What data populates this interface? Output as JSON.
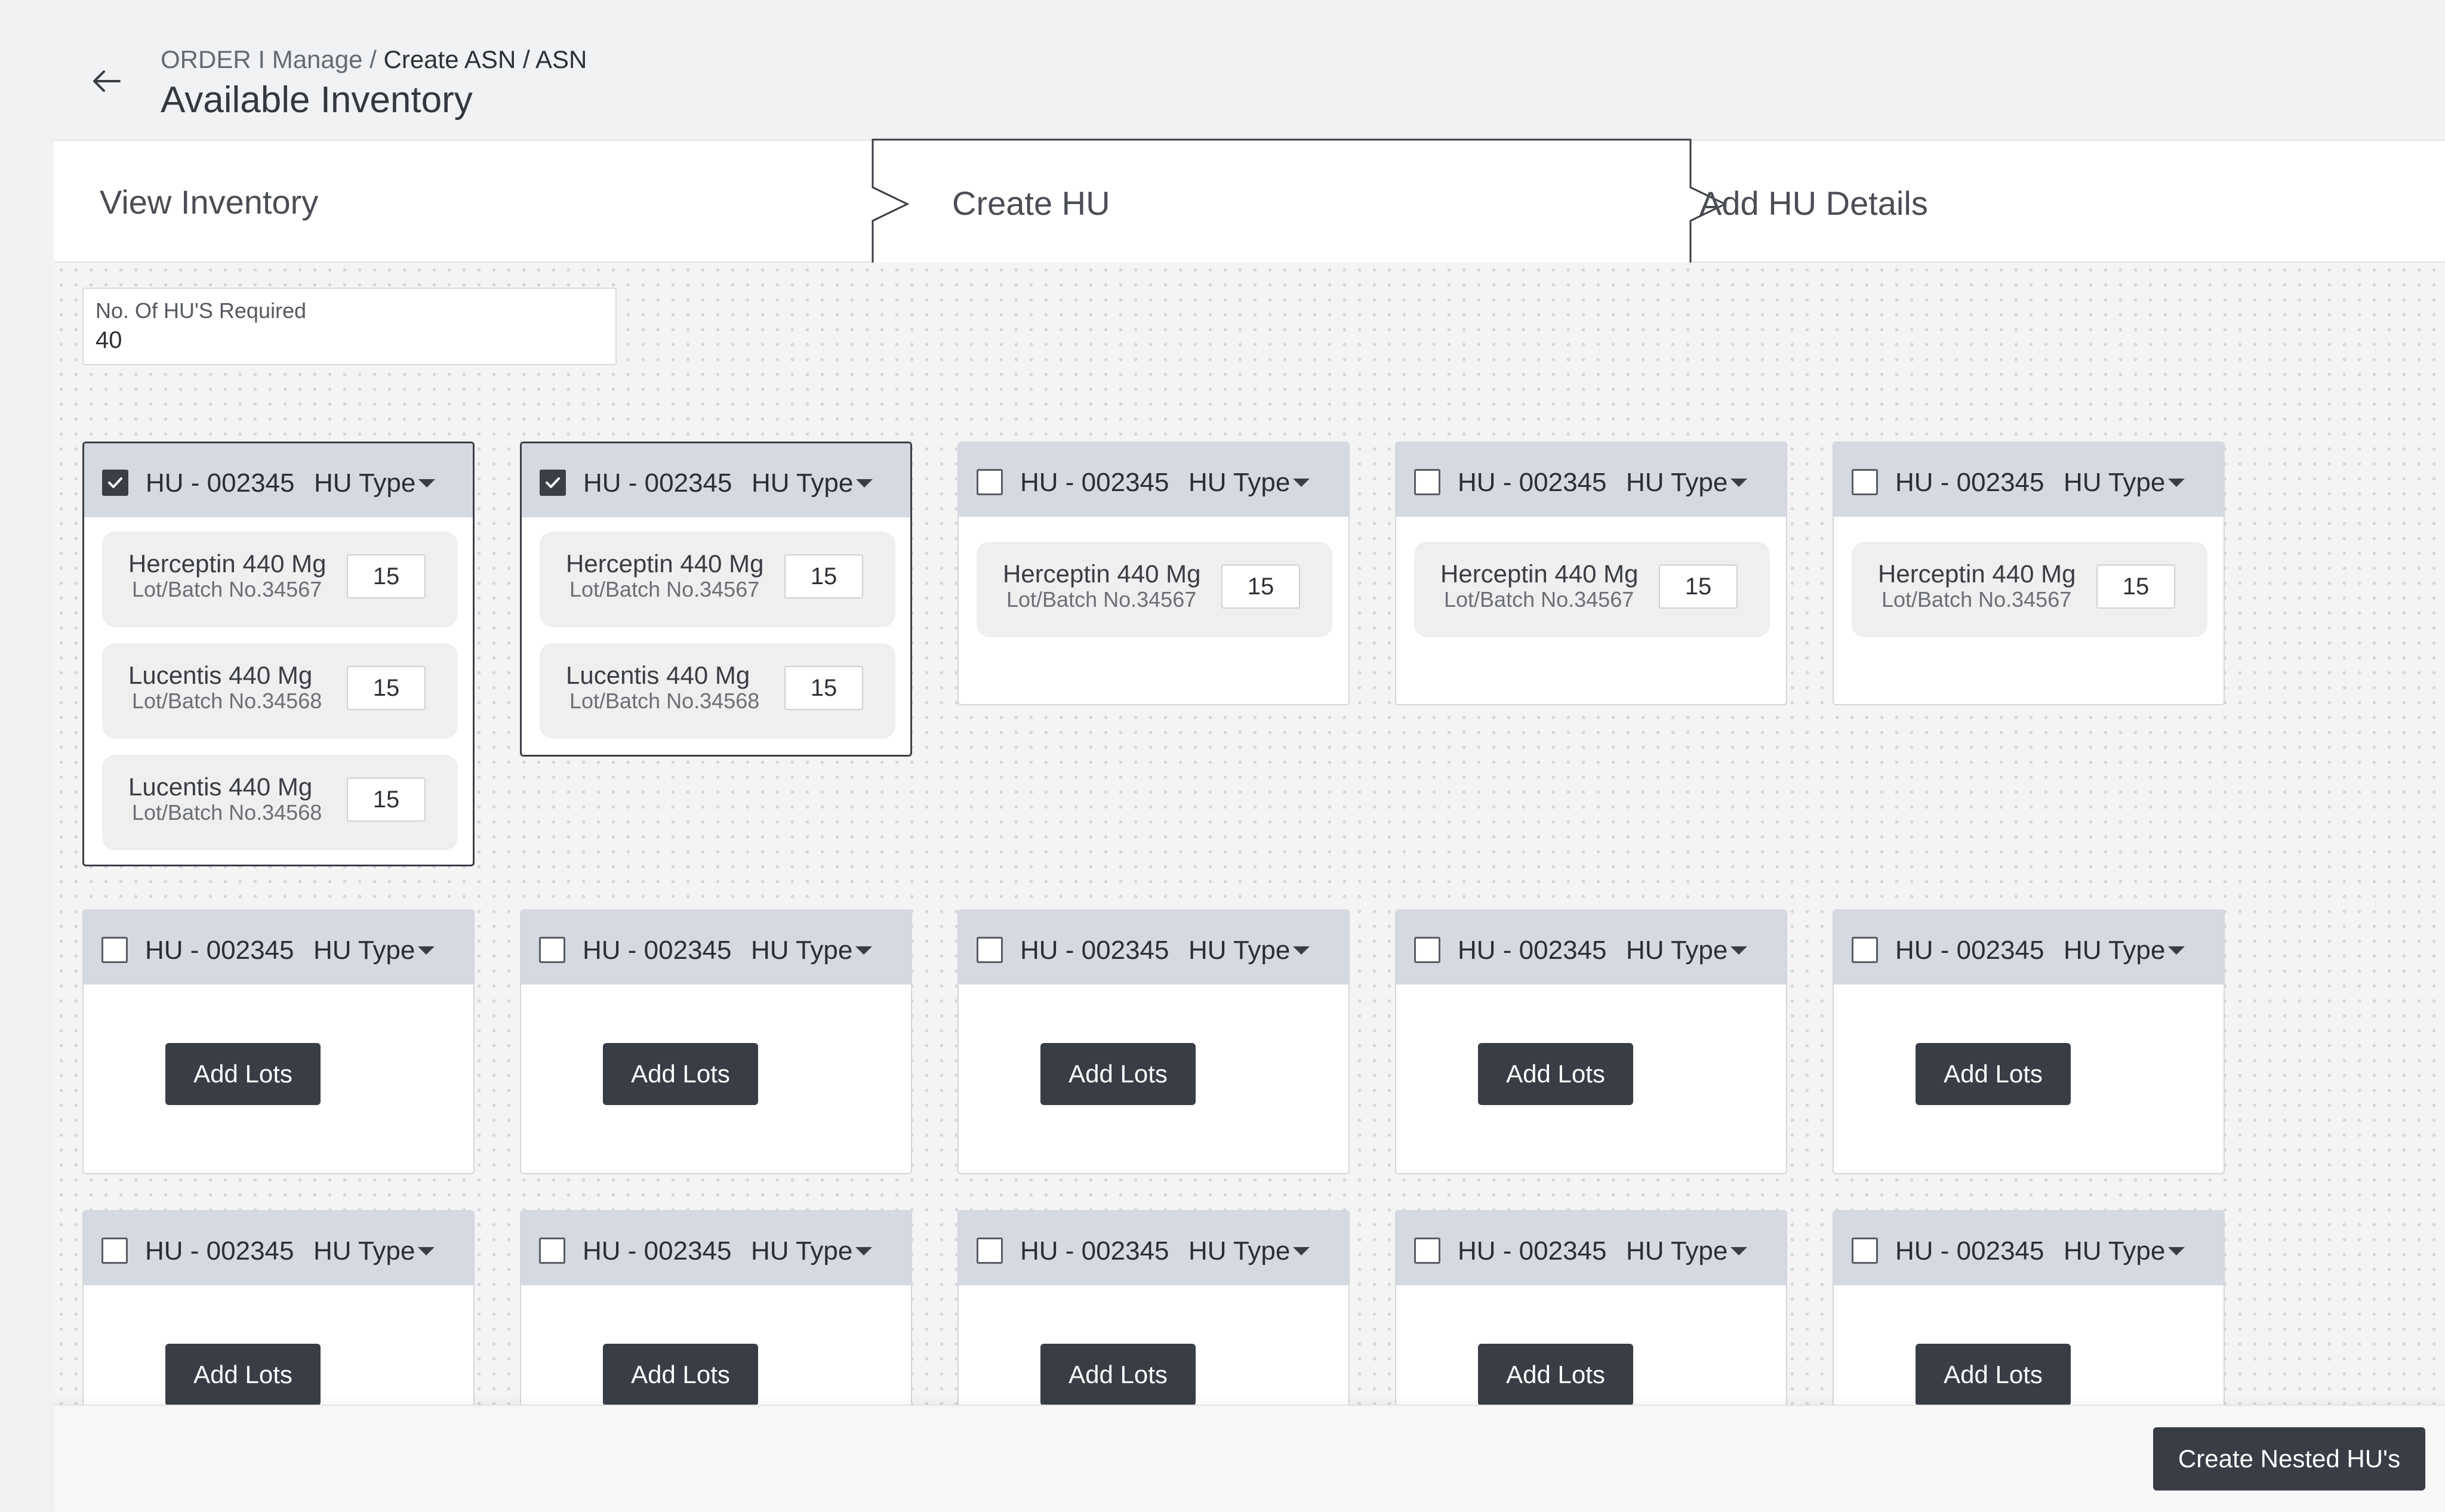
{
  "header": {
    "breadcrumb": {
      "part1": "ORDER",
      "sep1": " I ",
      "part2": "Manage",
      "sep2": " / ",
      "part3": "Create ASN / ASN"
    },
    "title": "Available Inventory"
  },
  "stepper": {
    "steps": [
      {
        "label": "View Inventory"
      },
      {
        "label": "Create HU"
      },
      {
        "label": "Add HU Details"
      }
    ],
    "active_step": "Create HU"
  },
  "hu_count": {
    "label": "No. Of HU'S Required",
    "value": "40"
  },
  "cards": [
    {
      "id": "HU - 002345",
      "type_label": "HU Type",
      "checked": true,
      "lots": [
        {
          "name": "Herceptin 440 Mg",
          "batch": "Lot/Batch No.34567",
          "qty": "15"
        },
        {
          "name": "Lucentis 440 Mg",
          "batch": "Lot/Batch No.34568",
          "qty": "15"
        },
        {
          "name": "Lucentis 440 Mg",
          "batch": "Lot/Batch No.34568",
          "qty": "15"
        }
      ]
    },
    {
      "id": "HU - 002345",
      "type_label": "HU Type",
      "checked": true,
      "lots": [
        {
          "name": "Herceptin 440 Mg",
          "batch": "Lot/Batch No.34567",
          "qty": "15"
        },
        {
          "name": "Lucentis 440 Mg",
          "batch": "Lot/Batch No.34568",
          "qty": "15"
        }
      ]
    },
    {
      "id": "HU - 002345",
      "type_label": "HU Type",
      "checked": false,
      "lots": [
        {
          "name": "Herceptin 440 Mg",
          "batch": "Lot/Batch No.34567",
          "qty": "15"
        }
      ]
    },
    {
      "id": "HU - 002345",
      "type_label": "HU Type",
      "checked": false,
      "lots": [
        {
          "name": "Herceptin 440 Mg",
          "batch": "Lot/Batch No.34567",
          "qty": "15"
        }
      ]
    },
    {
      "id": "HU - 002345",
      "type_label": "HU Type",
      "checked": false,
      "lots": [
        {
          "name": "Herceptin 440 Mg",
          "batch": "Lot/Batch No.34567",
          "qty": "15"
        }
      ]
    },
    {
      "id": "HU - 002345",
      "type_label": "HU Type",
      "checked": false,
      "add_lots_label": "Add Lots"
    },
    {
      "id": "HU - 002345",
      "type_label": "HU Type",
      "checked": false,
      "add_lots_label": "Add Lots"
    },
    {
      "id": "HU - 002345",
      "type_label": "HU Type",
      "checked": false,
      "add_lots_label": "Add Lots"
    },
    {
      "id": "HU - 002345",
      "type_label": "HU Type",
      "checked": false,
      "add_lots_label": "Add Lots"
    },
    {
      "id": "HU - 002345",
      "type_label": "HU Type",
      "checked": false,
      "add_lots_label": "Add Lots"
    },
    {
      "id": "HU - 002345",
      "type_label": "HU Type",
      "checked": false,
      "add_lots_label": "Add Lots"
    },
    {
      "id": "HU - 002345",
      "type_label": "HU Type",
      "checked": false,
      "add_lots_label": "Add Lots"
    },
    {
      "id": "HU - 002345",
      "type_label": "HU Type",
      "checked": false,
      "add_lots_label": "Add Lots"
    },
    {
      "id": "HU - 002345",
      "type_label": "HU Type",
      "checked": false,
      "add_lots_label": "Add Lots"
    },
    {
      "id": "HU - 002345",
      "type_label": "HU Type",
      "checked": false,
      "add_lots_label": "Add Lots"
    }
  ],
  "footer": {
    "create_nested_label": "Create Nested HU's"
  },
  "icons": {
    "back": "arrow-left-icon",
    "check": "checkmark-icon",
    "dropdown": "caret-down-icon"
  },
  "colors": {
    "primary_button": "#393d46",
    "card_header": "#d5dae2",
    "lot_tile": "#efefef"
  }
}
